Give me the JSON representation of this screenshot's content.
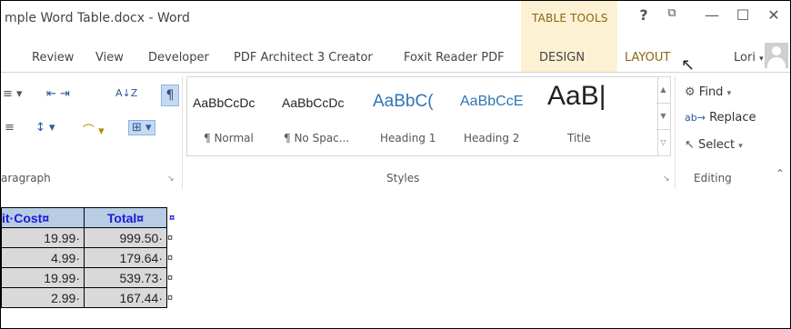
{
  "window": {
    "title": "mple Word Table.docx - Word",
    "context_label": "TABLE TOOLS",
    "help": "?",
    "restore": "⧉",
    "minimize": "—",
    "maximize": "☐",
    "close": "✕"
  },
  "tabs": [
    "Review",
    "View",
    "Developer",
    "PDF Architect 3 Creator",
    "Foxit Reader PDF",
    "DESIGN",
    "LAYOUT"
  ],
  "user": {
    "name": "Lori",
    "caret": "▾"
  },
  "paragraph_group": {
    "label": "aragraph",
    "row1": [
      "≡ ▾",
      "⇤ ⇥",
      "A↓Z",
      "¶"
    ],
    "row2": [
      "≡",
      "↕ ▾",
      "⌒ ▾",
      "⊞ ▾"
    ]
  },
  "styles_group": {
    "label": "Styles",
    "items": [
      {
        "preview": "AaBbCcDc",
        "name": "¶ Normal"
      },
      {
        "preview": "AaBbCcDc",
        "name": "¶ No Spac..."
      },
      {
        "preview": "AaBbC(",
        "name": "Heading 1"
      },
      {
        "preview": "AaBbCcE",
        "name": "Heading 2"
      },
      {
        "preview": "AaB|",
        "name": "Title"
      }
    ]
  },
  "editing_group": {
    "label": "Editing",
    "find": "Find",
    "replace": "Replace",
    "select": "Select"
  },
  "table": {
    "headers": [
      "it·Cost¤",
      "Total¤"
    ],
    "rows": [
      [
        "19.99·",
        "999.50·"
      ],
      [
        "4.99·",
        "179.64·"
      ],
      [
        "19.99·",
        "539.73·"
      ],
      [
        "2.99·",
        "167.44·"
      ]
    ],
    "end_mark": "¤"
  },
  "colors": {
    "context_tab": "#8d6414",
    "context_bg": "#fcf1d2",
    "table_header_bg": "#b8cce4",
    "table_header_text": "#1a1ad8",
    "table_cell_bg": "#d9d9d9"
  }
}
